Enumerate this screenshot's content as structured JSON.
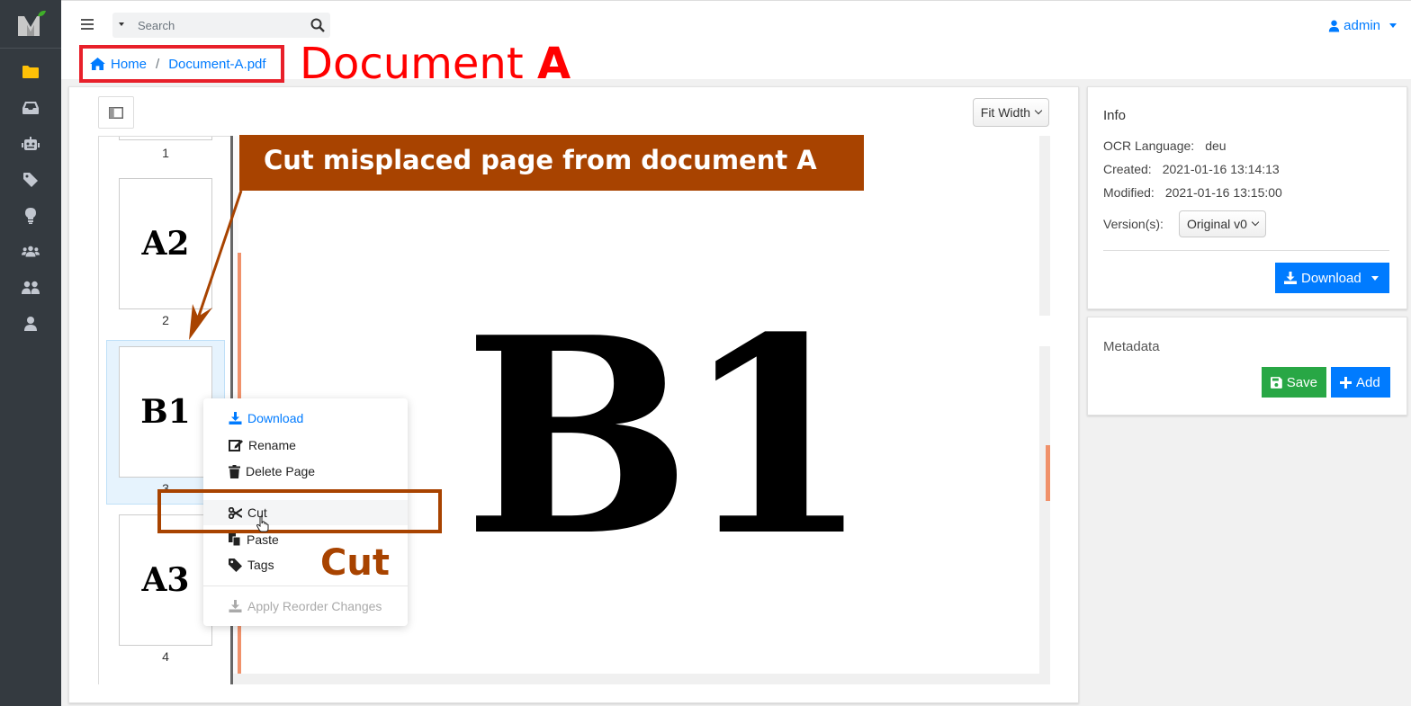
{
  "app": {
    "logo": "papermerge-logo"
  },
  "sidebar": {
    "items": [
      {
        "name": "documents",
        "icon": "folder-icon",
        "active": true
      },
      {
        "name": "inbox",
        "icon": "inbox-icon"
      },
      {
        "name": "automates",
        "icon": "robot-icon"
      },
      {
        "name": "tags",
        "icon": "tag-icon"
      },
      {
        "name": "hints",
        "icon": "lightbulb-icon"
      },
      {
        "name": "groups",
        "icon": "users-group-icon"
      },
      {
        "name": "users",
        "icon": "users-icon"
      },
      {
        "name": "account",
        "icon": "user-icon"
      }
    ]
  },
  "topbar": {
    "search_placeholder": "Search",
    "user_label": "admin"
  },
  "breadcrumb": {
    "home": "Home",
    "separator": "/",
    "current": "Document-A.pdf"
  },
  "annotations": {
    "doc_label_prefix": "Document ",
    "doc_label_letter": "A",
    "callout": "Cut misplaced page from document A",
    "cut_label": "Cut"
  },
  "viewer": {
    "zoom_label": "Fit Width",
    "current_page_text": "B1",
    "thumbnails": [
      {
        "label": "",
        "number": "1"
      },
      {
        "label": "A2",
        "number": "2"
      },
      {
        "label": "B1",
        "number": "3",
        "selected": true
      },
      {
        "label": "A3",
        "number": "4"
      }
    ]
  },
  "context_menu": {
    "items": [
      {
        "label": "Download",
        "icon": "download-icon"
      },
      {
        "label": "Rename",
        "icon": "edit-icon"
      },
      {
        "label": "Delete Page",
        "icon": "trash-icon"
      },
      {
        "label": "Cut",
        "icon": "scissors-icon",
        "highlighted": true
      },
      {
        "label": "Paste",
        "icon": "paste-icon"
      },
      {
        "label": "Tags",
        "icon": "tag-icon"
      },
      {
        "label": "Apply Reorder Changes",
        "icon": "download-icon",
        "disabled": true
      }
    ]
  },
  "info": {
    "title": "Info",
    "ocr_language_label": "OCR Language:",
    "ocr_language_value": "deu",
    "created_label": "Created:",
    "created_value": "2021-01-16 13:14:13",
    "modified_label": "Modified:",
    "modified_value": "2021-01-16 13:15:00",
    "versions_label": "Version(s):",
    "version_selected": "Original v0",
    "download_label": "Download"
  },
  "metadata": {
    "title": "Metadata",
    "save_label": "Save",
    "add_label": "Add"
  },
  "colors": {
    "primary": "#007bff",
    "success": "#28a745",
    "annotation_brown": "#a84300",
    "annotation_red": "#ff0000",
    "sidebar_bg": "#343a40",
    "active_icon": "#ffc107"
  }
}
